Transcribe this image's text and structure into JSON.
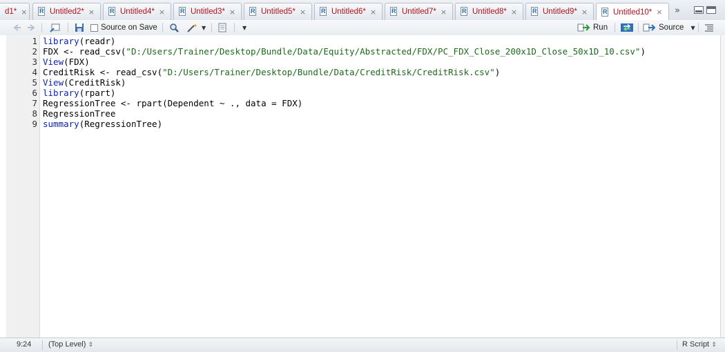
{
  "tabs": [
    {
      "label": "d1*",
      "active": false
    },
    {
      "label": "Untitled2*",
      "active": false
    },
    {
      "label": "Untitled4*",
      "active": false
    },
    {
      "label": "Untitled3*",
      "active": false
    },
    {
      "label": "Untitled5*",
      "active": false
    },
    {
      "label": "Untitled6*",
      "active": false
    },
    {
      "label": "Untitled7*",
      "active": false
    },
    {
      "label": "Untitled8*",
      "active": false
    },
    {
      "label": "Untitled9*",
      "active": false
    },
    {
      "label": "Untitled10*",
      "active": true
    }
  ],
  "tab_close_glyph": "×",
  "tab_more_glyph": "»",
  "toolbar": {
    "source_on_save": "Source on Save",
    "run": "Run",
    "source": "Source"
  },
  "editor": {
    "line_numbers": [
      "1",
      "2",
      "3",
      "4",
      "5",
      "6",
      "7",
      "8",
      "9"
    ],
    "lines": [
      "library(readr)",
      "FDX <- read_csv(\"D:/Users/Trainer/Desktop/Bundle/Data/Equity/Abstracted/FDX/PC_FDX_Close_200x1D_Close_50x1D_10.csv\")",
      "View(FDX)",
      "CreditRisk <- read_csv(\"D:/Users/Trainer/Desktop/Bundle/Data/CreditRisk/CreditRisk.csv\")",
      "View(CreditRisk)",
      "library(rpart)",
      "RegressionTree <- rpart(Dependent ~ ., data = FDX)",
      "RegressionTree",
      "summary(RegressionTree)"
    ]
  },
  "status": {
    "cursor": "9:24",
    "scope": "(Top Level)",
    "language": "R Script"
  },
  "colors": {
    "tab_label": "#b3121a",
    "keyword": "#0b22b8",
    "string": "#1a6b18"
  }
}
